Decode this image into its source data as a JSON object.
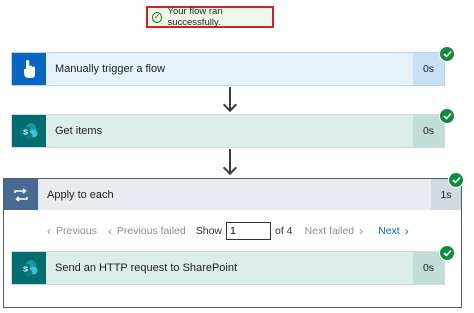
{
  "toast": {
    "message": "Your flow ran successfully.",
    "icon": "check-circle-icon"
  },
  "steps": [
    {
      "label": "Manually trigger a flow",
      "duration": "0s",
      "icon": "touch-icon",
      "color": "#0a66c2"
    },
    {
      "label": "Get items",
      "duration": "0s",
      "icon": "sharepoint-icon",
      "color": "#036c70"
    }
  ],
  "apply_to_each": {
    "label": "Apply to each",
    "duration": "1s",
    "icon": "loop-icon",
    "color": "#486991",
    "pager": {
      "previous": "Previous",
      "previous_failed": "Previous failed",
      "show": "Show",
      "current_value": "1",
      "of_total": "of 4",
      "next_failed": "Next failed",
      "next": "Next"
    },
    "inner_step": {
      "label": "Send an HTTP request to SharePoint",
      "duration": "0s",
      "icon": "sharepoint-icon",
      "color": "#036c70"
    }
  },
  "colors": {
    "success": "#0f8c3b",
    "card_bg": "#dbeceb",
    "duration_bg": "#c2ddd9",
    "toast_border": "#c8262b"
  }
}
